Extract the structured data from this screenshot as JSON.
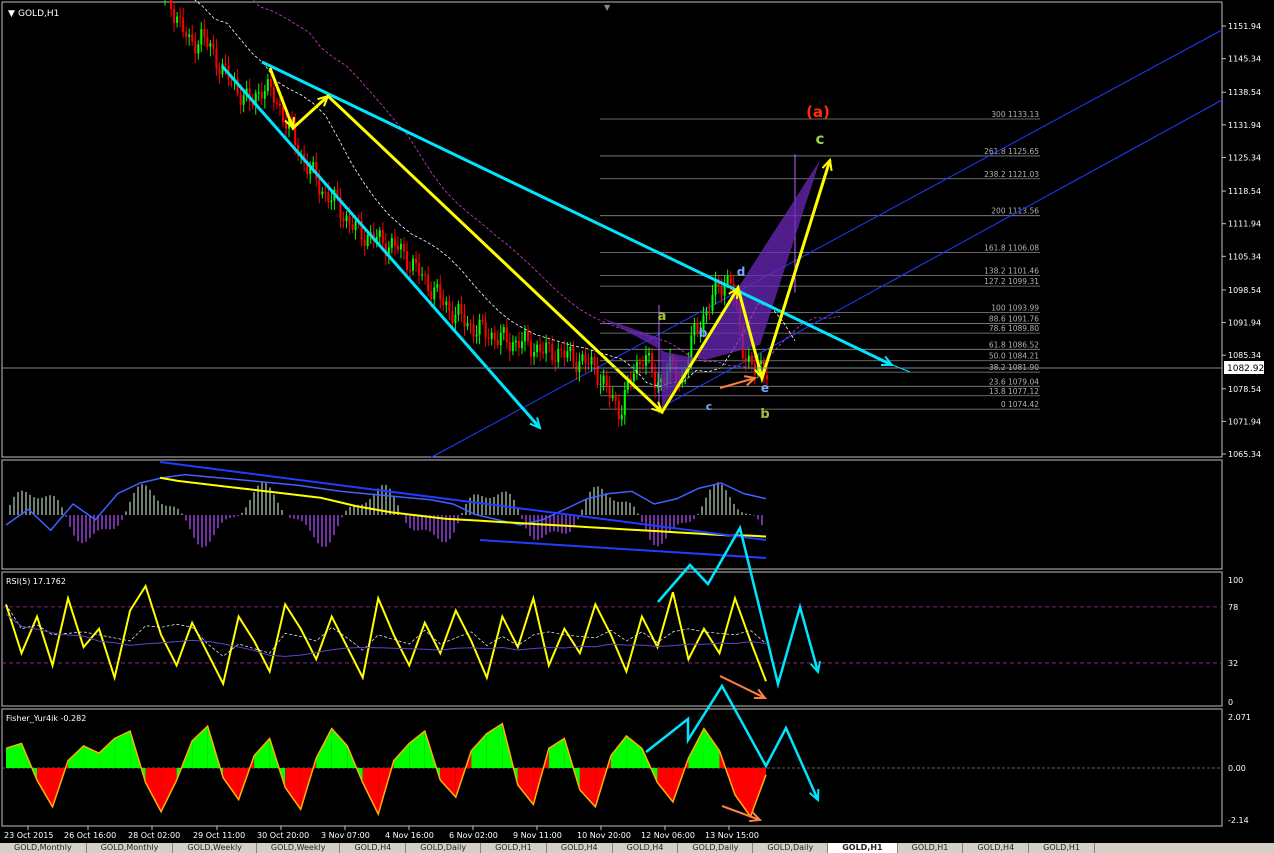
{
  "window": {
    "symbol_label": "GOLD,H1",
    "current_price": "1082.92"
  },
  "colors": {
    "bull": "#00ff00",
    "bear": "#ff0000",
    "trend": "#00e5ff",
    "wave": "#ffff00",
    "pattern": "#7a2fc8",
    "channel": "#1f3cff"
  },
  "chart_data": [
    {
      "type": "candlestick",
      "pane": "main",
      "symbol": "GOLD,H1",
      "y_ticks": [
        "1151.94",
        "1145.34",
        "1138.54",
        "1131.94",
        "1125.34",
        "1118.54",
        "1111.94",
        "1105.34",
        "1098.54",
        "1091.94",
        "1085.34",
        "1078.54",
        "1071.94",
        "1065.34"
      ],
      "ylim": [
        1063.4,
        1154.6
      ],
      "x_ticks": [
        "23 Oct 2015",
        "26 Oct 16:00",
        "28 Oct 02:00",
        "29 Oct 11:00",
        "30 Oct 20:00",
        "3 Nov 07:00",
        "4 Nov 16:00",
        "6 Nov 02:00",
        "9 Nov 11:00",
        "10 Nov 20:00",
        "12 Nov 06:00",
        "13 Nov 15:00"
      ],
      "close_path": [
        1158,
        1154,
        1148,
        1150,
        1146,
        1142,
        1139,
        1136,
        1140,
        1137,
        1132,
        1126,
        1122,
        1118,
        1116,
        1112,
        1110,
        1109,
        1108,
        1107,
        1104,
        1101,
        1098,
        1095,
        1093,
        1091,
        1090,
        1089,
        1088,
        1088,
        1087,
        1086,
        1086,
        1085,
        1084,
        1083,
        1078,
        1074,
        1081,
        1086,
        1079,
        1083,
        1080,
        1089,
        1094,
        1099,
        1101,
        1087,
        1082,
        1082.92
      ],
      "fib_levels": [
        {
          "label": "300 1133.13",
          "price": 1133.13
        },
        {
          "label": "261.8 1125.65",
          "price": 1125.65
        },
        {
          "label": "238.2 1121.03",
          "price": 1121.03
        },
        {
          "label": "200 1113.56",
          "price": 1113.56
        },
        {
          "label": "161.8 1106.08",
          "price": 1106.08
        },
        {
          "label": "138.2 1101.46",
          "price": 1101.46
        },
        {
          "label": "127.2 1099.31",
          "price": 1099.31
        },
        {
          "label": "100 1093.99",
          "price": 1093.99
        },
        {
          "label": "88.6 1091.76",
          "price": 1091.76
        },
        {
          "label": "78.6 1089.80",
          "price": 1089.8
        },
        {
          "label": "61.8 1086.52",
          "price": 1086.52
        },
        {
          "label": "50.0 1084.21",
          "price": 1084.21
        },
        {
          "label": "38.2 1081.90",
          "price": 1081.9
        },
        {
          "label": "23.6 1079.04",
          "price": 1079.04
        },
        {
          "label": "13.8 1077.12",
          "price": 1077.12
        },
        {
          "label": "0 1074.42",
          "price": 1074.42
        }
      ],
      "wave_labels": [
        "(a)",
        "c",
        "d",
        "a",
        "b",
        "c",
        "e",
        "b"
      ]
    },
    {
      "type": "line",
      "pane": "indicator-1",
      "series": [
        {
          "values": [
            40,
            55,
            35,
            60,
            45,
            70,
            80,
            85,
            88,
            86,
            84,
            82,
            80,
            78,
            75,
            72,
            70,
            68,
            66,
            64,
            60,
            50,
            45,
            40,
            45,
            55,
            65,
            70,
            72,
            60,
            65,
            75,
            80,
            70,
            65
          ]
        },
        {
          "values": [
            85,
            82,
            80,
            78,
            76,
            74,
            72,
            70,
            68,
            66,
            62,
            58,
            55,
            52,
            50,
            48,
            46,
            45,
            44,
            43,
            42,
            41,
            40,
            39,
            38,
            37,
            36,
            35,
            34,
            33,
            32,
            31,
            30,
            30,
            29
          ]
        }
      ]
    },
    {
      "type": "line",
      "pane": "rsi",
      "title": "RSI(5) 17.1762",
      "y_ticks": [
        "100",
        "78",
        "32",
        "0"
      ],
      "ylim": [
        0,
        100
      ],
      "series": [
        {
          "values": [
            80,
            40,
            70,
            30,
            85,
            45,
            60,
            20,
            75,
            95,
            55,
            30,
            65,
            40,
            15,
            70,
            50,
            25,
            80,
            60,
            35,
            70,
            45,
            20,
            85,
            55,
            30,
            65,
            40,
            75,
            50,
            20,
            70,
            45,
            85,
            30,
            60,
            40,
            80,
            55,
            25,
            70,
            45,
            90,
            35,
            60,
            40,
            85,
            50,
            17
          ]
        }
      ]
    },
    {
      "type": "area",
      "pane": "fisher",
      "title": "Fisher_Yur4ik -0.282",
      "y_ticks": [
        "2.071",
        "0.00",
        "-2.14"
      ],
      "ylim": [
        -2.14,
        2.071
      ],
      "series": [
        {
          "values": [
            0.8,
            1.0,
            -0.5,
            -1.6,
            0.3,
            0.9,
            0.6,
            1.2,
            1.5,
            -0.6,
            -1.8,
            -0.5,
            1.1,
            1.7,
            -0.4,
            -1.3,
            0.5,
            1.2,
            -0.8,
            -1.7,
            0.4,
            1.6,
            0.9,
            -0.6,
            -1.9,
            0.3,
            1.0,
            1.5,
            -0.5,
            -1.2,
            0.7,
            1.4,
            1.8,
            -0.7,
            -1.5,
            0.8,
            1.2,
            -0.9,
            -1.6,
            0.5,
            1.3,
            0.8,
            -0.6,
            -1.4,
            0.4,
            1.6,
            0.7,
            -1.1,
            -2.0,
            -0.28
          ]
        }
      ]
    }
  ],
  "tabs": [
    "GOLD,Monthly",
    "GOLD,Monthly",
    "GOLD,Weekly",
    "GOLD,Weekly",
    "GOLD,H4",
    "GOLD,Daily",
    "GOLD,H1",
    "GOLD,H4",
    "GOLD,H4",
    "GOLD,Daily",
    "GOLD,Daily",
    "GOLD,H1",
    "GOLD,H1",
    "GOLD,H4",
    "GOLD,H1"
  ]
}
